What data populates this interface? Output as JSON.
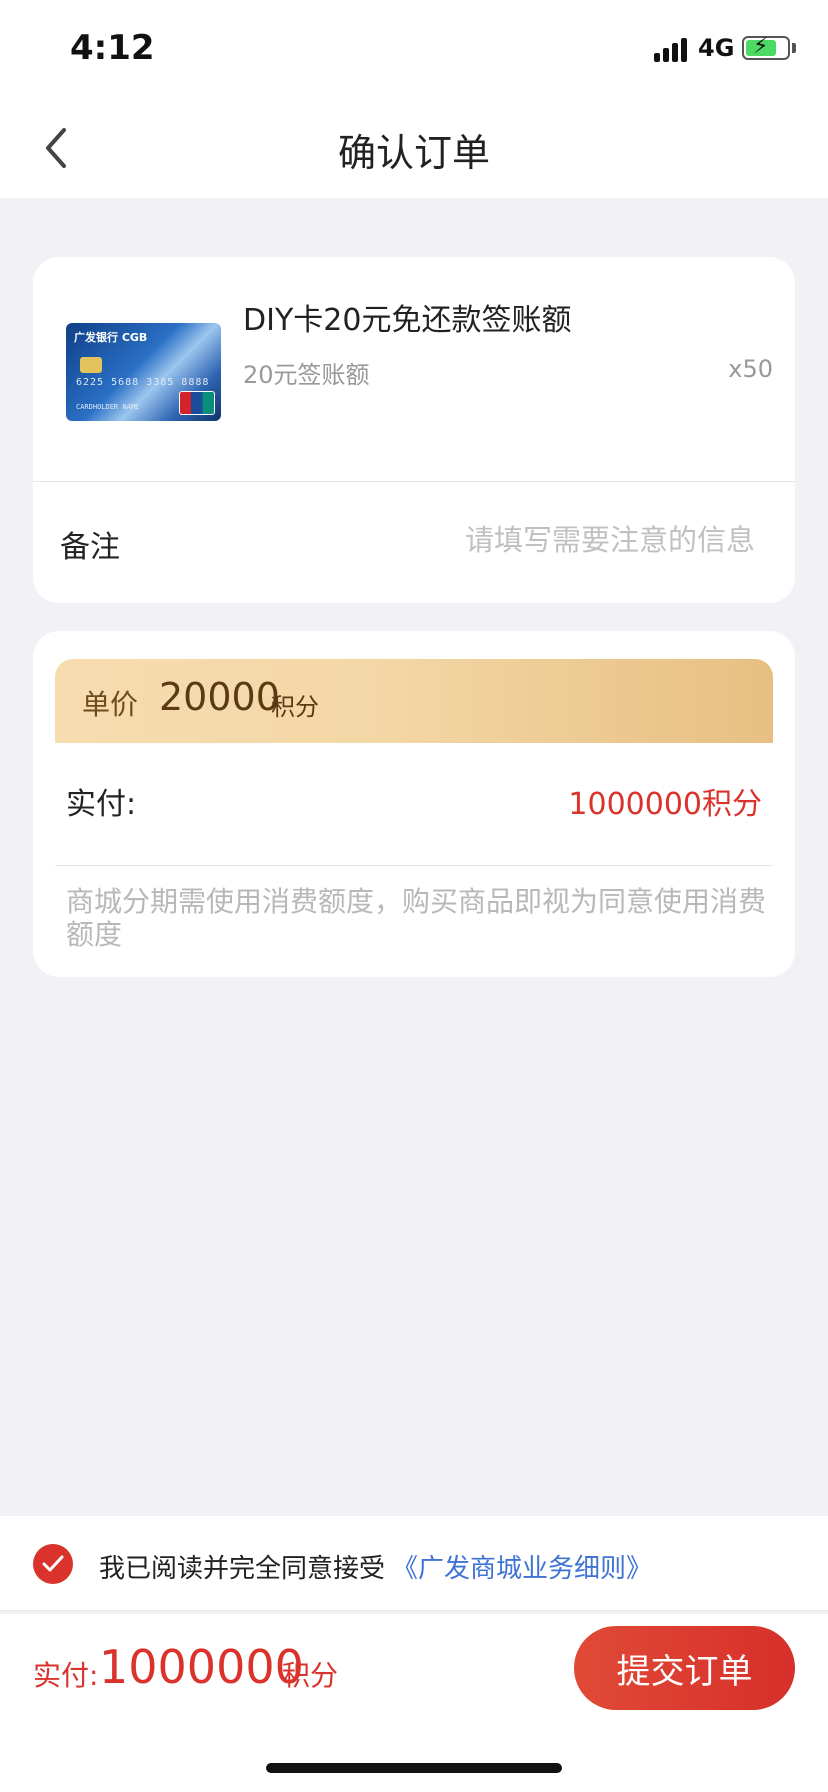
{
  "status_bar": {
    "time": "4:12",
    "network": "4G"
  },
  "nav": {
    "title": "确认订单"
  },
  "product": {
    "card_image": {
      "bank_text": "广发银行 CGB",
      "card_number": "6225 5688 3385 8888",
      "holder": "CARDHOLDER NAME"
    },
    "title": "DIY卡20元免还款签账额",
    "subtitle": "20元签账额",
    "quantity": "x50"
  },
  "remark": {
    "label": "备注",
    "placeholder": "请填写需要注意的信息",
    "value": ""
  },
  "price": {
    "label": "单价",
    "value": "20000",
    "unit": "积分"
  },
  "payment": {
    "label": "实付:",
    "value": "1000000积分"
  },
  "notice": "商城分期需使用消费额度，购买商品即视为同意使用消费额度",
  "agreement": {
    "text": "我已阅读并完全同意接受",
    "link": "《广发商城业务细则》",
    "checked": true
  },
  "bottom_bar": {
    "label": "实付:",
    "value": "1000000",
    "unit": "积分",
    "submit": "提交订单"
  },
  "colors": {
    "accent": "#d9332c",
    "link": "#3f73d6",
    "banner": "#f3d7a6"
  }
}
